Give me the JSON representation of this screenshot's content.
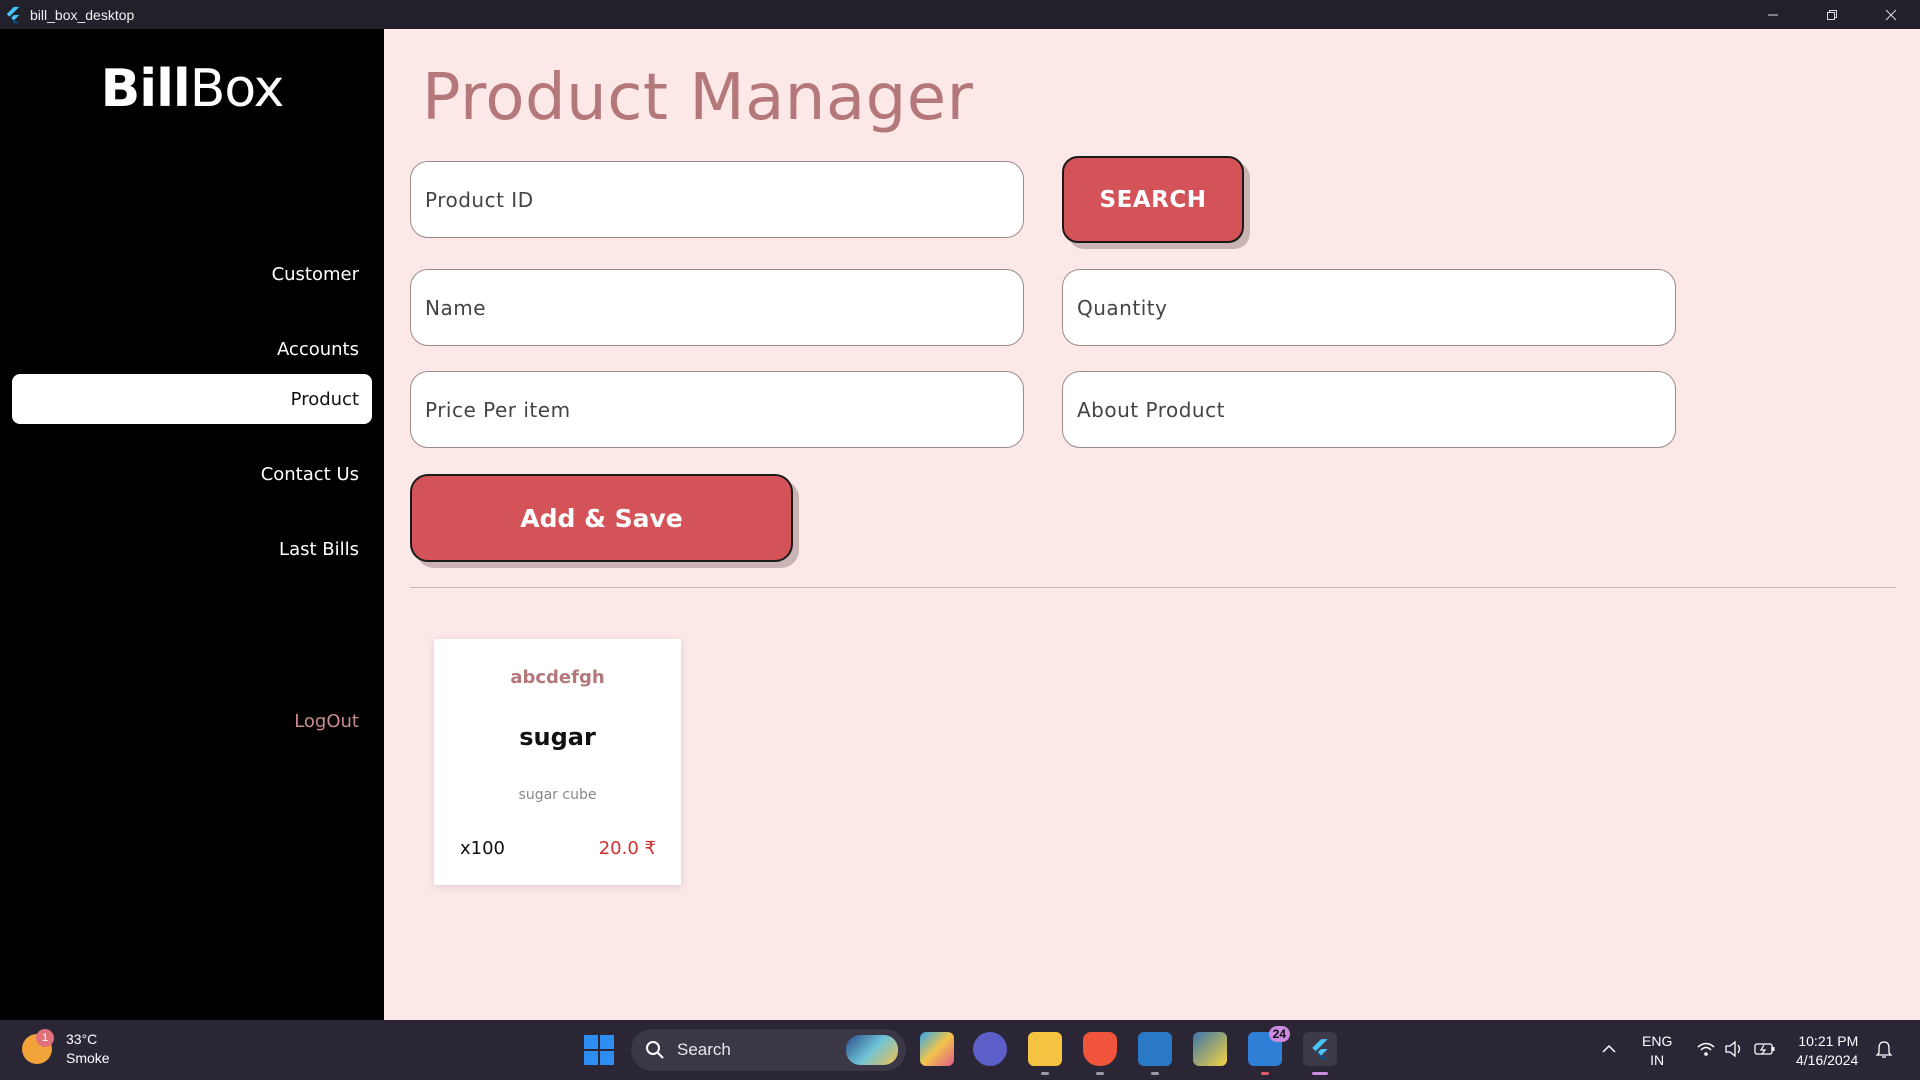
{
  "window": {
    "title": "bill_box_desktop",
    "controls": [
      "minimize",
      "restore",
      "close"
    ]
  },
  "sidebar": {
    "logo_bold": "Bill",
    "logo_light": "Box",
    "items": [
      {
        "label": "Customer",
        "active": false
      },
      {
        "label": "Accounts",
        "active": false
      },
      {
        "label": "Product",
        "active": true
      },
      {
        "label": "Contact Us",
        "active": false
      },
      {
        "label": "Last Bills",
        "active": false
      }
    ],
    "logout_label": "LogOut"
  },
  "main": {
    "title": "Product Manager",
    "fields": {
      "product_id": {
        "placeholder": "Product ID",
        "value": ""
      },
      "name": {
        "placeholder": "Name",
        "value": ""
      },
      "quantity": {
        "placeholder": "Quantity",
        "value": ""
      },
      "price": {
        "placeholder": "Price Per item",
        "value": ""
      },
      "about": {
        "placeholder": "About Product",
        "value": ""
      }
    },
    "search_button": "SEARCH",
    "save_button": "Add & Save",
    "products": [
      {
        "id": "abcdefgh",
        "name": "sugar",
        "description": "sugar cube",
        "quantity": "x100",
        "price": "20.0 ₹"
      }
    ]
  },
  "colors": {
    "accent": "#d45358",
    "title": "#b4787a",
    "background": "#fde8e8",
    "sidebar": "#000000",
    "price": "#d03030"
  },
  "taskbar": {
    "weather": {
      "temp": "33°C",
      "condition": "Smoke",
      "badge": "1"
    },
    "search_label": "Search",
    "apps": [
      "copilot-icon",
      "teams-icon",
      "file-explorer-icon",
      "brave-icon",
      "vscode-icon",
      "python-icon",
      "todo-icon",
      "flutter-icon"
    ],
    "app_badge": "24",
    "lang_top": "ENG",
    "lang_bottom": "IN",
    "time": "10:21 PM",
    "date": "4/16/2024"
  }
}
